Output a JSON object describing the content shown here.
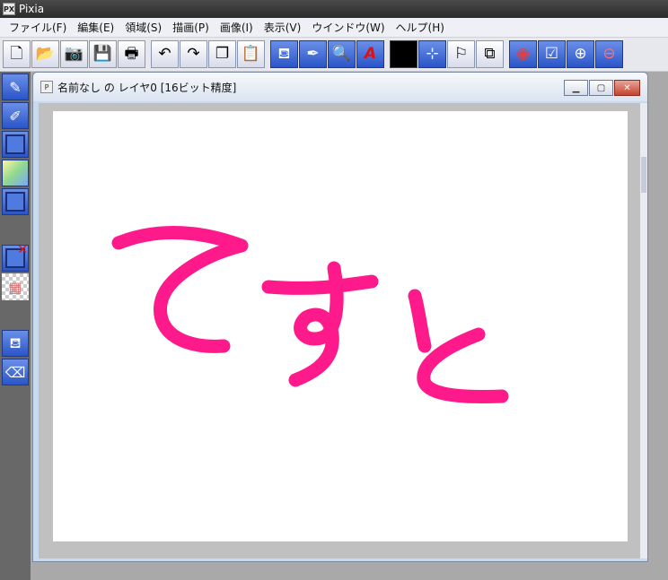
{
  "app": {
    "title": "Pixia",
    "icon": "pixia-logo-icon"
  },
  "menu": [
    "ファイル(F)",
    "編集(E)",
    "領域(S)",
    "描画(P)",
    "画像(I)",
    "表示(V)",
    "ウインドウ(W)",
    "ヘルプ(H)"
  ],
  "toolbar_icons": [
    "new-file-icon",
    "open-folder-icon",
    "camera-icon",
    "save-icon",
    "print-icon",
    "undo-icon",
    "redo-icon",
    "copy-icon",
    "paste-icon",
    "paint-bucket-icon",
    "pen-brush-icon",
    "zoom-lens-icon",
    "text-tool-icon",
    "color-swatch-icon",
    "select-icon",
    "transform-icon",
    "layer-icon",
    "circle-icon",
    "checklist-icon",
    "zoom-in-icon",
    "zoom-out-icon"
  ],
  "tools": [
    "pen-icon",
    "pen-outline-icon",
    "rect-select-icon",
    "gradient-icon",
    "rect-icon",
    "clear-layer-icon",
    "transparency-icon",
    "fill-bucket-icon",
    "eraser-bucket-icon"
  ],
  "document": {
    "title": "名前なし の レイヤ0 [16ビット精度]"
  },
  "canvas": {
    "drawing": "pink handwritten text",
    "stroke_color": "#ff1a8c",
    "background": "#ffffff"
  },
  "colors": {
    "foreground": "#000000",
    "accent": "#2b55c8"
  }
}
